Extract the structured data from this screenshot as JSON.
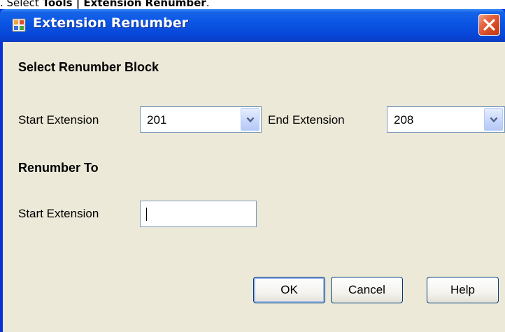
{
  "caption": {
    "prefix": ". Select ",
    "bold": "Tools | Extension Renumber",
    "suffix": "."
  },
  "window": {
    "title": "Extension Renumber"
  },
  "section1": {
    "heading": "Select Renumber Block",
    "start_label": "Start Extension",
    "start_value": "201",
    "end_label": "End Extension",
    "end_value": "208"
  },
  "section2": {
    "heading": "Renumber To",
    "start_label": "Start Extension",
    "start_value": ""
  },
  "buttons": {
    "ok": "OK",
    "cancel": "Cancel",
    "help": "Help"
  },
  "icons": {
    "app": "app-window-icon",
    "close": "close-icon",
    "dropdown": "chevron-down-icon"
  },
  "colors": {
    "titlebar": "#0a54e3",
    "close": "#d2461e",
    "client": "#ece9d8",
    "border": "#7f9db9"
  }
}
